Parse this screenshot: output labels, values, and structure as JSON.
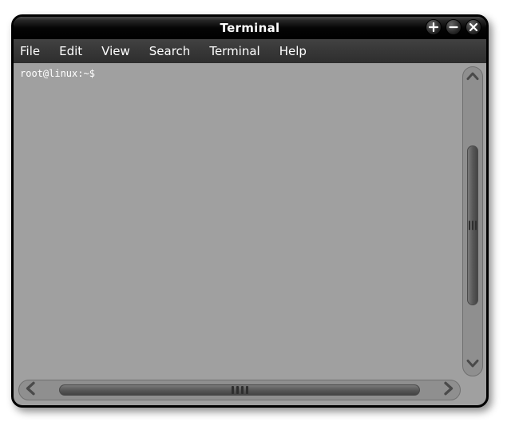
{
  "window": {
    "title": "Terminal"
  },
  "menu": {
    "file": "File",
    "edit": "Edit",
    "view": "View",
    "search": "Search",
    "terminal": "Terminal",
    "help": "Help"
  },
  "terminal": {
    "prompt": "root@linux:~$"
  }
}
